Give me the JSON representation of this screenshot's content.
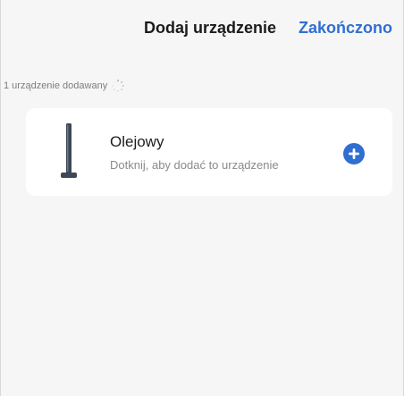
{
  "header": {
    "title": "Dodaj urządzenie",
    "done_label": "Zakończono"
  },
  "status": {
    "text": "1 urządzenie dodawany",
    "loading_icon": "spinner-icon"
  },
  "device": {
    "name": "Olejowy",
    "subtitle": "Dotknij, aby dodać to urządzenie",
    "image_icon": "oil-heater-tower-icon",
    "add_icon": "plus-circle-icon"
  },
  "colors": {
    "accent": "#2f6fd1",
    "background": "#f6f6f6",
    "card": "#ffffff",
    "title_text": "#1c1c1c",
    "secondary_text": "#8a8a8a"
  }
}
